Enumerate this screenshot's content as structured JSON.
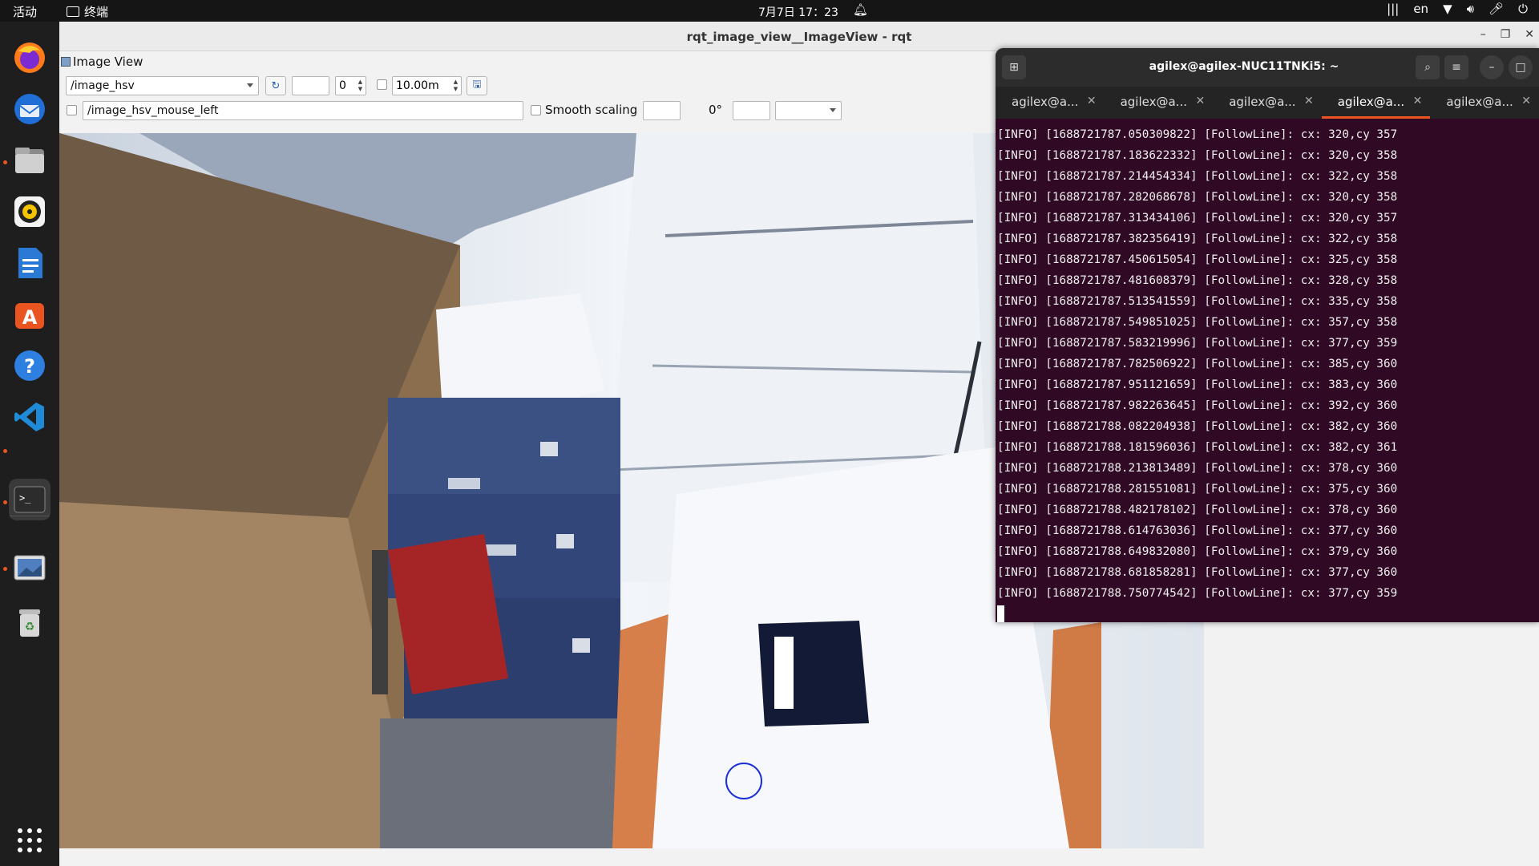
{
  "topbar": {
    "activities": "活动",
    "app_name": "终端",
    "clock": "7月7日 17：23",
    "lang": "en"
  },
  "dock": {
    "items": [
      "firefox-icon",
      "thunderbird-icon",
      "files-icon",
      "rhythmbox-icon",
      "writer-icon",
      "app-center-icon",
      "help-icon",
      "vscode-icon",
      "terminal-icon",
      "image-viewer-icon",
      "trash-icon",
      "app-grid-icon"
    ]
  },
  "rqt": {
    "window_title": "rqt_image_view__ImageView - rqt",
    "plugin_title": "Image View",
    "topic": "/image_hsv",
    "spin_value": "0",
    "distance": "10.00m",
    "mouse_topic": "/image_hsv_mouse_left",
    "smooth_scaling": "Smooth scaling",
    "rotation": "0°"
  },
  "terminal": {
    "title": "agilex@agilex-NUC11TNKi5: ~",
    "tabs": [
      "agilex@a...",
      "agilex@a...",
      "agilex@a...",
      "agilex@a...",
      "agilex@a..."
    ],
    "active_tab": 3,
    "lines": [
      "[INFO] [1688721787.050309822] [FollowLine]: cx: 320,cy 357",
      "[INFO] [1688721787.183622332] [FollowLine]: cx: 320,cy 358",
      "[INFO] [1688721787.214454334] [FollowLine]: cx: 322,cy 358",
      "[INFO] [1688721787.282068678] [FollowLine]: cx: 320,cy 358",
      "[INFO] [1688721787.313434106] [FollowLine]: cx: 320,cy 357",
      "[INFO] [1688721787.382356419] [FollowLine]: cx: 322,cy 358",
      "[INFO] [1688721787.450615054] [FollowLine]: cx: 325,cy 358",
      "[INFO] [1688721787.481608379] [FollowLine]: cx: 328,cy 358",
      "[INFO] [1688721787.513541559] [FollowLine]: cx: 335,cy 358",
      "[INFO] [1688721787.549851025] [FollowLine]: cx: 357,cy 358",
      "[INFO] [1688721787.583219996] [FollowLine]: cx: 377,cy 359",
      "[INFO] [1688721787.782506922] [FollowLine]: cx: 385,cy 360",
      "[INFO] [1688721787.951121659] [FollowLine]: cx: 383,cy 360",
      "[INFO] [1688721787.982263645] [FollowLine]: cx: 392,cy 360",
      "[INFO] [1688721788.082204938] [FollowLine]: cx: 382,cy 360",
      "[INFO] [1688721788.181596036] [FollowLine]: cx: 382,cy 361",
      "[INFO] [1688721788.213813489] [FollowLine]: cx: 378,cy 360",
      "[INFO] [1688721788.281551081] [FollowLine]: cx: 375,cy 360",
      "[INFO] [1688721788.482178102] [FollowLine]: cx: 378,cy 360",
      "[INFO] [1688721788.614763036] [FollowLine]: cx: 377,cy 360",
      "[INFO] [1688721788.649832080] [FollowLine]: cx: 379,cy 360",
      "[INFO] [1688721788.681858281] [FollowLine]: cx: 377,cy 360",
      "[INFO] [1688721788.750774542] [FollowLine]: cx: 377,cy 359"
    ]
  }
}
